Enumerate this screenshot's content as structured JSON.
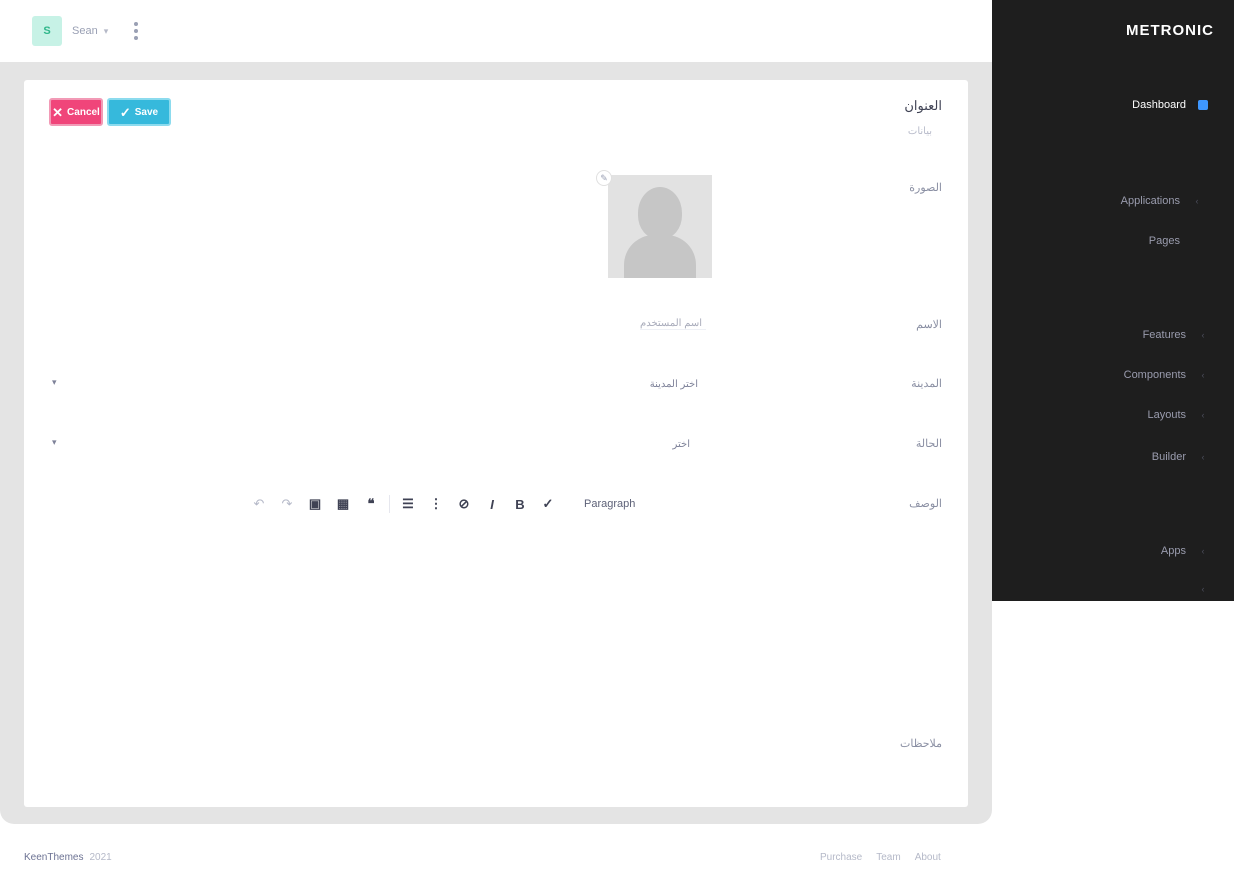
{
  "header": {
    "avatar_letter": "S",
    "user_name": "Sean",
    "dropdown_glyph": "▾"
  },
  "actions": {
    "cancel_icon": "✕",
    "cancel_label": "Cancel",
    "save_icon": "✓",
    "save_label": "Save"
  },
  "form": {
    "title": "العنوان",
    "subtitle": "بيانات",
    "image_label": "الصورة",
    "name_label": "الاسم",
    "name_value": "اسم المستخدم",
    "select1_label": "المدينة",
    "select1_value": "اختر المدينة",
    "select2_label": "الحالة",
    "select2_value": "اختر",
    "description_label": "الوصف",
    "notes_label": "ملاحظات"
  },
  "editor_toolbar": {
    "style_label": "Paragraph",
    "buttons": [
      "↶",
      "↷",
      "▣",
      "▦",
      "❝",
      "☰",
      "⋮",
      "⊘",
      "I",
      "B",
      "✓"
    ]
  },
  "footer": {
    "brand": "KeenThemes",
    "year": "2021",
    "links": [
      "Purchase",
      "Team",
      "About"
    ]
  },
  "sidebar": {
    "brand": "METRONIC",
    "items": [
      {
        "label": "Dashboard",
        "icon": "dashboard-icon"
      },
      {
        "label": "Applications",
        "icon": "chevron-icon"
      },
      {
        "label": "Pages",
        "icon": ""
      },
      {
        "label": "Features",
        "icon": "chevron-icon"
      },
      {
        "label": "Components",
        "icon": "chevron-icon"
      },
      {
        "label": "Layouts",
        "icon": "chevron-icon"
      },
      {
        "label": "Builder",
        "icon": "chevron-icon"
      },
      {
        "label": "Apps",
        "icon": "chevron-icon"
      }
    ]
  },
  "colors": {
    "accent": "#3e97ff",
    "cancel": "#f0457a",
    "save": "#36b9dc",
    "sidebar_bg": "#1e1e1e"
  }
}
